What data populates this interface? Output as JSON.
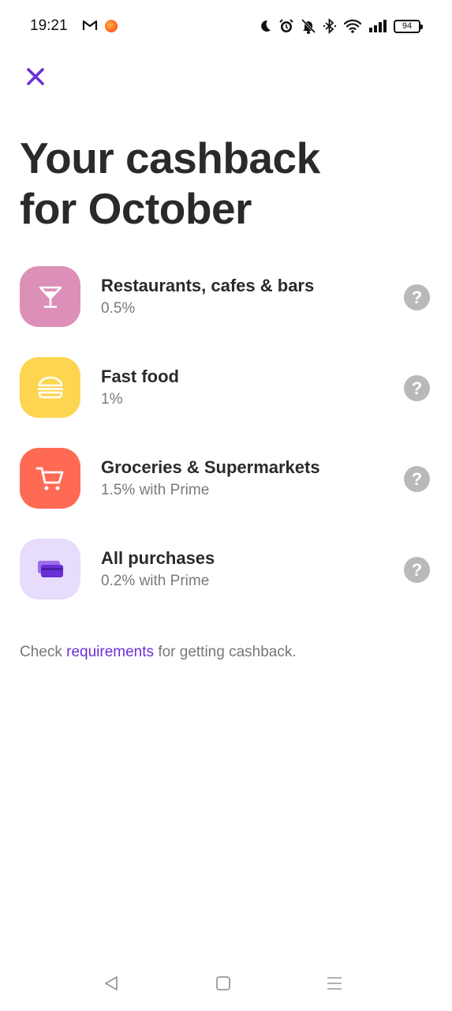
{
  "status_bar": {
    "time": "19:21",
    "battery": "94",
    "icons": [
      "gmail-icon",
      "notification-dot-icon",
      "moon-icon",
      "alarm-icon",
      "bell-off-icon",
      "bluetooth-icon",
      "wifi-icon",
      "signal-icon",
      "battery-icon"
    ]
  },
  "header": {
    "close_icon": "close-icon",
    "title_line1": "Your cashback",
    "title_line2": "for October"
  },
  "categories": [
    {
      "name": "Restaurants, cafes & bars",
      "rate": "0.5%",
      "icon": "cocktail-icon",
      "color": "#dc8fb7"
    },
    {
      "name": "Fast food",
      "rate": "1%",
      "icon": "burger-icon",
      "color": "#fdd551"
    },
    {
      "name": "Groceries & Supermarkets",
      "rate": "1.5% with Prime",
      "icon": "cart-icon",
      "color": "#ff6a55"
    },
    {
      "name": "All purchases",
      "rate": "0.2% with Prime",
      "icon": "card-icon",
      "color": "#e7dcfb"
    }
  ],
  "help_label": "?",
  "footer": {
    "prefix": "Check",
    "link": "requirements",
    "suffix": "for getting cashback."
  },
  "colors": {
    "accent": "#6b2fd6",
    "help_button": "#b9b9b9"
  },
  "nav_bar": {
    "icons": [
      "back-icon",
      "home-icon",
      "menu-icon"
    ]
  }
}
